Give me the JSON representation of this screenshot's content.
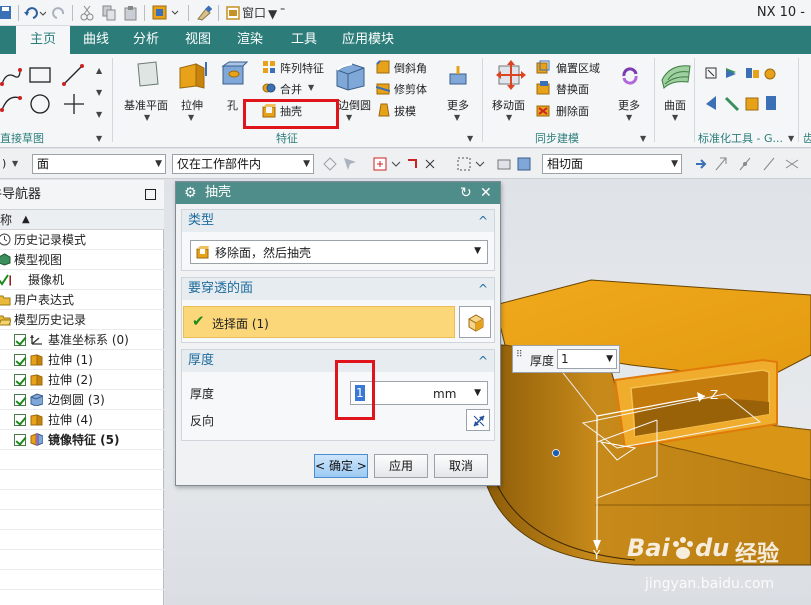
{
  "app": {
    "title": "NX 10 -"
  },
  "quick_access": {
    "window_menu": "窗口"
  },
  "ribbon": {
    "tabs": [
      "主页",
      "曲线",
      "分析",
      "视图",
      "渲染",
      "工具",
      "应用模块"
    ],
    "active_tab": "主页",
    "groups": {
      "sketch": "直接草图",
      "feature": "特征",
      "sync": "同步建模",
      "std": "标准化工具 - G...",
      "std_more": "齿"
    },
    "buttons": {
      "datum_plane": "基准平面",
      "extrude": "拉伸",
      "hole": "孔",
      "pattern": "阵列特征",
      "unite": "合并",
      "shell": "抽壳",
      "edge_blend": "边倒圆",
      "chamfer": "倒斜角",
      "trim_body": "修剪体",
      "draft": "拔模",
      "more1": "更多",
      "move_face": "移动面",
      "offset_region": "偏置区域",
      "replace_face": "替换面",
      "delete_face": "删除面",
      "more2": "更多",
      "surface": "曲面"
    }
  },
  "selection_bar": {
    "filter": "面",
    "scope": "仅在工作部件内",
    "snap": "相切面"
  },
  "navigator": {
    "title": "部件导航器",
    "header": "名称",
    "rows": [
      {
        "label": "历史记录模式",
        "checked": false
      },
      {
        "label": "模型视图",
        "checked": false
      },
      {
        "label": "摄像机",
        "checked": false
      },
      {
        "label": "用户表达式",
        "checked": false
      },
      {
        "label": "模型历史记录",
        "checked": false
      },
      {
        "label": "基准坐标系 (0)",
        "checked": true
      },
      {
        "label": "拉伸 (1)",
        "checked": true
      },
      {
        "label": "拉伸 (2)",
        "checked": true
      },
      {
        "label": "边倒圆 (3)",
        "checked": true
      },
      {
        "label": "拉伸 (4)",
        "checked": true
      },
      {
        "label": "镜像特征 (5)",
        "checked": true
      }
    ]
  },
  "dialog": {
    "title": "抽壳",
    "type_section": "类型",
    "type_value": "移除面，然后抽壳",
    "pierce_section": "要穿透的面",
    "select_face": "选择面 (1)",
    "thickness_section": "厚度",
    "thickness_label": "厚度",
    "thickness_value": "1",
    "unit": "mm",
    "reverse_label": "反向",
    "ok": "< 确定 >",
    "apply": "应用",
    "cancel": "取消"
  },
  "viewport": {
    "thickness_tag_label": "厚度",
    "thickness_tag_value": "1",
    "axis_z": "Z",
    "axis_y": "Y"
  },
  "watermark": {
    "brand": "Bai",
    "brand2": "du",
    "brand_cn": "经验",
    "url": "jingyan.baidu.com"
  }
}
